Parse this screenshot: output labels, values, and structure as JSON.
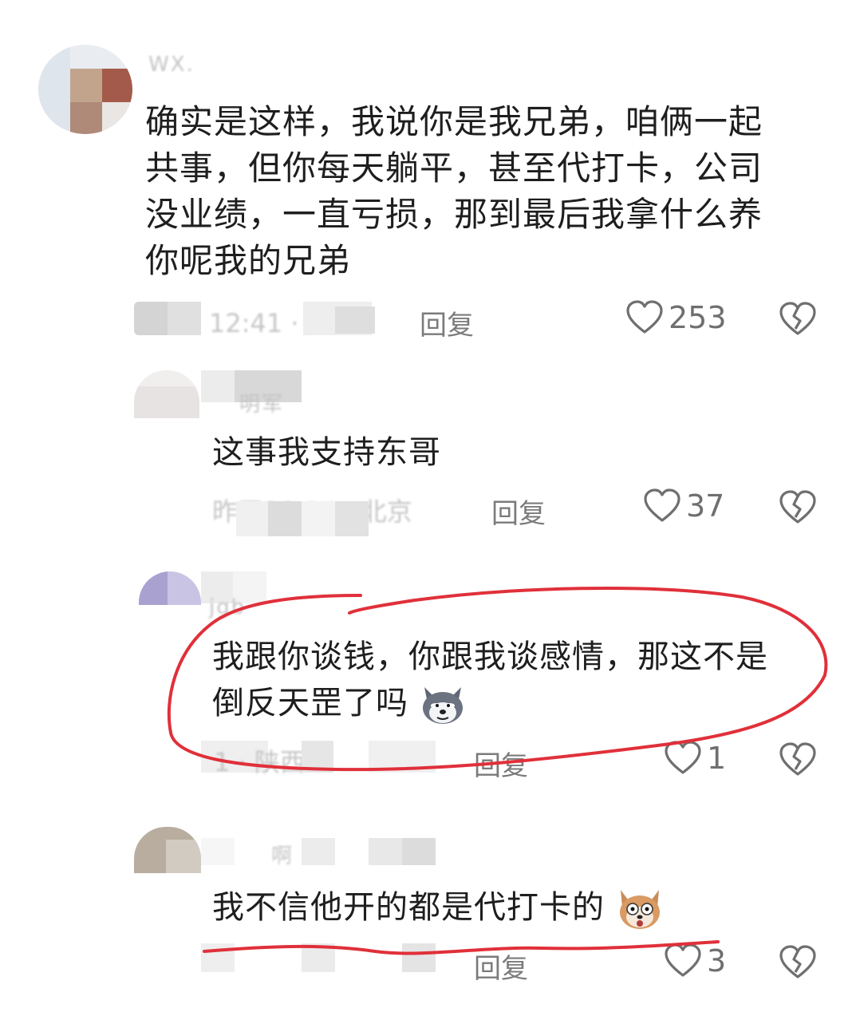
{
  "comments": [
    {
      "username": "WX.",
      "text_lines": [
        "确实是这样，我说你是我兄弟，咱俩一起",
        "共事，但你每天躺平，甚至代打卡，公司",
        "没业绩，一直亏损，那到最后我拿什么养",
        "你呢我的兄弟"
      ],
      "meta": "12:41 · 广州",
      "reply_label": "回复",
      "likes": "253"
    },
    {
      "username": "明军",
      "text": "这事我支持东哥",
      "meta": "昨天20:34 · 北京",
      "reply_label": "回复",
      "likes": "37"
    },
    {
      "username": "jgb",
      "text_lines": [
        "我跟你谈钱，你跟我谈感情，那这不是",
        "倒反天罡了吗"
      ],
      "meta": "1 · 陕西",
      "reply_label": "回复",
      "likes": "1"
    },
    {
      "username": "啊",
      "text": "我不信他开的都是代打卡的",
      "meta": "",
      "reply_label": "回复",
      "likes": "3"
    }
  ],
  "colors": {
    "annotation_red": "#e0303a",
    "text": "#1e1e1e",
    "reply": "#7b7b7b"
  },
  "icons": [
    "heart-outline-icon",
    "broken-heart-icon",
    "husky-emoji-icon",
    "dog-shocked-emoji-icon"
  ]
}
